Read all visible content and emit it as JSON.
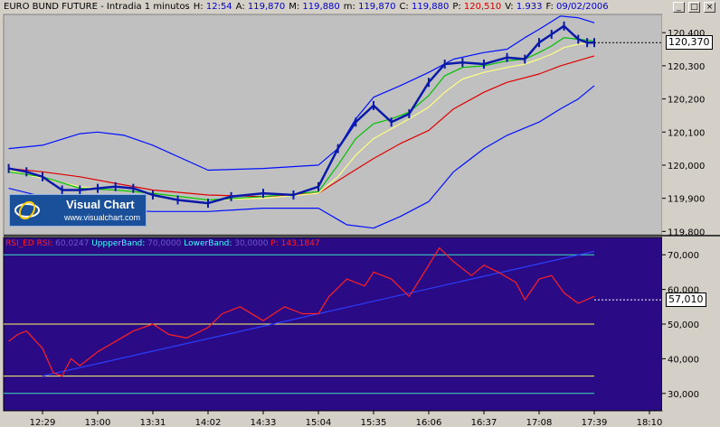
{
  "window": {
    "title_items": [
      {
        "label": "EURO BUND FUTURE - Intradia 1 minutos",
        "value": "",
        "style": "k"
      },
      {
        "label": "H:",
        "value": "12:54",
        "style": "v"
      },
      {
        "label": "A:",
        "value": "119,870",
        "style": "v"
      },
      {
        "label": "M:",
        "value": "119,880",
        "style": "v"
      },
      {
        "label": "m:",
        "value": "119,870",
        "style": "v"
      },
      {
        "label": "C:",
        "value": "119,880",
        "style": "v"
      },
      {
        "label": "P:",
        "value": "120,510",
        "style": "vr"
      },
      {
        "label": "V:",
        "value": "1.933",
        "style": "v"
      },
      {
        "label": "F:",
        "value": "09/02/2006",
        "style": "v"
      }
    ],
    "buttons": {
      "minimize": "_",
      "maximize": "□",
      "close": "×"
    }
  },
  "logo": {
    "name": "Visual Chart",
    "url": "www.visualchart.com"
  },
  "rsi_legend": {
    "parts": [
      {
        "text": "RSI_ED",
        "style": "r"
      },
      {
        "text": " RSI:",
        "style": "r"
      },
      {
        "text": " 60,0247",
        "style": "d"
      },
      {
        "text": "  UppperBand:",
        "style": "c"
      },
      {
        "text": " 70,0000",
        "style": "d"
      },
      {
        "text": "  LowerBand:",
        "style": "c"
      },
      {
        "text": " 30,0000",
        "style": "d"
      },
      {
        "text": "  P:",
        "style": "r"
      },
      {
        "text": " 143,1847",
        "style": "r"
      }
    ]
  },
  "colors": {
    "price_bg": "#c0c0c0",
    "rsi_bg": "#2b0a86",
    "price": "#0a1aa8",
    "bollinger": "#0010ff",
    "ma_fast": "#00c000",
    "ma_mid": "#ffff80",
    "ma_slow": "#e00000",
    "rsi": "#ff2020",
    "band_upper": "#40e0c0",
    "band_mid": "#ffff66",
    "trend": "#2a40ff"
  },
  "chart_data": [
    {
      "type": "line",
      "title": "EURO BUND FUTURE - Intradia 1 minutos",
      "x_ticks": [
        "12:29",
        "13:00",
        "13:31",
        "14:02",
        "14:33",
        "15:04",
        "15:35",
        "16:06",
        "16:37",
        "17:08",
        "17:39",
        "18:10"
      ],
      "y_ticks": [
        "120,400",
        "120,300",
        "120,200",
        "120,100",
        "120,000",
        "119,900",
        "119,800"
      ],
      "ylim": [
        119.79,
        120.455
      ],
      "last_value": "120,370",
      "last_value_num": 120.37,
      "series": [
        {
          "role": "price",
          "x": [
            "12:10",
            "12:20",
            "12:29",
            "12:40",
            "12:50",
            "13:00",
            "13:10",
            "13:20",
            "13:31",
            "13:45",
            "14:02",
            "14:15",
            "14:33",
            "14:50",
            "15:04",
            "15:15",
            "15:25",
            "15:35",
            "15:45",
            "15:55",
            "16:06",
            "16:15",
            "16:25",
            "16:37",
            "16:50",
            "17:00",
            "17:08",
            "17:15",
            "17:22",
            "17:30",
            "17:35",
            "17:39"
          ],
          "values": [
            119.99,
            119.98,
            119.965,
            119.925,
            119.925,
            119.93,
            119.935,
            119.93,
            119.91,
            119.895,
            119.885,
            119.905,
            119.915,
            119.91,
            119.935,
            120.05,
            120.13,
            120.18,
            120.13,
            120.155,
            120.25,
            120.305,
            120.31,
            120.305,
            120.325,
            120.32,
            120.37,
            120.395,
            120.42,
            120.38,
            120.37,
            120.37
          ]
        },
        {
          "role": "ma_fast",
          "x": [
            "12:10",
            "12:29",
            "12:50",
            "13:10",
            "13:31",
            "14:02",
            "14:33",
            "15:04",
            "15:15",
            "15:25",
            "15:35",
            "15:45",
            "15:55",
            "16:06",
            "16:15",
            "16:25",
            "16:37",
            "16:50",
            "17:00",
            "17:08",
            "17:15",
            "17:22",
            "17:30",
            "17:39"
          ],
          "values": [
            119.98,
            119.965,
            119.93,
            119.925,
            119.915,
            119.895,
            119.905,
            119.92,
            120.0,
            120.08,
            120.125,
            120.14,
            120.16,
            120.21,
            120.27,
            120.295,
            120.3,
            120.315,
            120.32,
            120.34,
            120.36,
            120.385,
            120.38,
            120.375
          ]
        },
        {
          "role": "ma_mid",
          "x": [
            "12:10",
            "12:29",
            "12:50",
            "13:10",
            "13:31",
            "14:02",
            "14:33",
            "15:04",
            "15:15",
            "15:25",
            "15:35",
            "15:45",
            "15:55",
            "16:06",
            "16:15",
            "16:25",
            "16:37",
            "16:50",
            "17:00",
            "17:08",
            "17:15",
            "17:22",
            "17:30",
            "17:39"
          ],
          "values": [
            119.985,
            119.96,
            119.935,
            119.925,
            119.915,
            119.895,
            119.9,
            119.915,
            119.965,
            120.03,
            120.08,
            120.11,
            120.14,
            120.175,
            120.22,
            120.26,
            120.28,
            120.295,
            120.305,
            120.32,
            120.335,
            120.355,
            120.365,
            120.37
          ]
        },
        {
          "role": "ma_slow",
          "x": [
            "12:10",
            "12:29",
            "12:50",
            "13:10",
            "13:31",
            "14:02",
            "14:33",
            "15:04",
            "15:20",
            "15:35",
            "15:50",
            "16:06",
            "16:20",
            "16:37",
            "16:50",
            "17:08",
            "17:20",
            "17:39"
          ],
          "values": [
            119.99,
            119.98,
            119.965,
            119.945,
            119.925,
            119.91,
            119.905,
            119.915,
            119.97,
            120.02,
            120.065,
            120.105,
            120.17,
            120.22,
            120.25,
            120.275,
            120.3,
            120.33
          ]
        },
        {
          "role": "bb_upper",
          "x": [
            "12:10",
            "12:29",
            "12:50",
            "13:00",
            "13:15",
            "13:31",
            "14:02",
            "14:33",
            "15:04",
            "15:15",
            "15:25",
            "15:35",
            "15:50",
            "16:06",
            "16:20",
            "16:37",
            "16:50",
            "17:00",
            "17:08",
            "17:20",
            "17:30",
            "17:39"
          ],
          "values": [
            120.05,
            120.06,
            120.095,
            120.1,
            120.09,
            120.06,
            119.985,
            119.99,
            120.0,
            120.05,
            120.14,
            120.205,
            120.24,
            120.28,
            120.32,
            120.34,
            120.35,
            120.385,
            120.41,
            120.45,
            120.445,
            120.43
          ]
        },
        {
          "role": "bb_lower",
          "x": [
            "12:10",
            "12:29",
            "12:50",
            "13:10",
            "13:31",
            "14:02",
            "14:33",
            "15:04",
            "15:20",
            "15:35",
            "15:50",
            "16:06",
            "16:20",
            "16:37",
            "16:50",
            "17:08",
            "17:20",
            "17:30",
            "17:39"
          ],
          "values": [
            119.93,
            119.905,
            119.875,
            119.865,
            119.86,
            119.86,
            119.87,
            119.87,
            119.82,
            119.81,
            119.845,
            119.89,
            119.98,
            120.05,
            120.09,
            120.13,
            120.17,
            120.2,
            120.24
          ]
        }
      ]
    },
    {
      "type": "line",
      "title": "RSI_ED",
      "x_ticks": [
        "12:29",
        "13:00",
        "13:31",
        "14:02",
        "14:33",
        "15:04",
        "15:35",
        "16:06",
        "16:37",
        "17:08",
        "17:39",
        "18:10"
      ],
      "y_ticks": [
        "70,000",
        "60,000",
        "50,000",
        "40,000",
        "30,000"
      ],
      "ylim": [
        25,
        75
      ],
      "last_value": "57,010",
      "last_value_num": 57.01,
      "bands": {
        "upper": 70,
        "middle": 50,
        "lower": 35,
        "bottom": 30
      },
      "series": [
        {
          "role": "rsi",
          "x": [
            "12:10",
            "12:15",
            "12:20",
            "12:29",
            "12:35",
            "12:40",
            "12:45",
            "12:50",
            "13:00",
            "13:10",
            "13:20",
            "13:31",
            "13:40",
            "13:50",
            "14:02",
            "14:10",
            "14:20",
            "14:33",
            "14:45",
            "14:55",
            "15:04",
            "15:10",
            "15:20",
            "15:30",
            "15:35",
            "15:45",
            "15:55",
            "16:06",
            "16:12",
            "16:20",
            "16:30",
            "16:37",
            "16:45",
            "16:55",
            "17:00",
            "17:08",
            "17:15",
            "17:22",
            "17:30",
            "17:39"
          ],
          "values": [
            45,
            47,
            48,
            43,
            36,
            35,
            40,
            38,
            42,
            45,
            48,
            50,
            47,
            46,
            49,
            53,
            55,
            51,
            55,
            53,
            53,
            58,
            63,
            61,
            65,
            63,
            58,
            67,
            72,
            68,
            64,
            67,
            65,
            62,
            57,
            63,
            64,
            59,
            56,
            58
          ]
        },
        {
          "role": "trend",
          "x": [
            "12:29",
            "17:39"
          ],
          "values": [
            35,
            71
          ]
        }
      ]
    }
  ]
}
